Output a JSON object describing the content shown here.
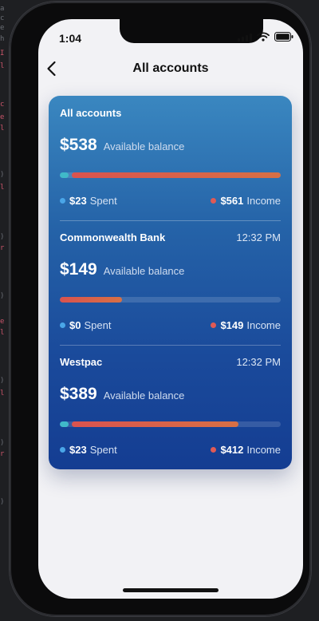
{
  "status_bar": {
    "time": "1:04"
  },
  "nav": {
    "title": "All accounts"
  },
  "accounts": [
    {
      "name": "All accounts",
      "time": "",
      "balance": "$538",
      "balance_label": "Available balance",
      "spent": "$23",
      "spent_label": "Spent",
      "income": "$561",
      "income_label": "Income",
      "spent_fraction": 0.04,
      "income_fraction": 0.96
    },
    {
      "name": "Commonwealth Bank",
      "time": "12:32 PM",
      "balance": "$149",
      "balance_label": "Available balance",
      "spent": "$0",
      "spent_label": "Spent",
      "income": "$149",
      "income_label": "Income",
      "spent_fraction": 0,
      "income_fraction": 0.28
    },
    {
      "name": "Westpac",
      "time": "12:32 PM",
      "balance": "$389",
      "balance_label": "Available balance",
      "spent": "$23",
      "spent_label": "Spent",
      "income": "$412",
      "income_label": "Income",
      "spent_fraction": 0.04,
      "income_fraction": 0.77
    }
  ],
  "colors": {
    "card_top": "#3a87c0",
    "card_bottom": "#143d92",
    "spent": "#40b9c9",
    "income": "#d9534f",
    "background": "#f2f2f5"
  },
  "icons": [
    "back-chevron-icon",
    "signal-icon",
    "wifi-icon",
    "battery-icon"
  ]
}
